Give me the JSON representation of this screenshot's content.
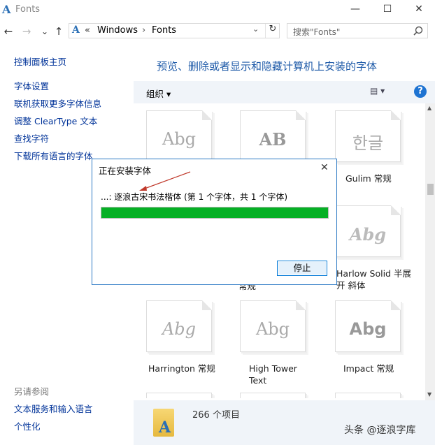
{
  "window": {
    "title": "Fonts",
    "minimize": "—",
    "maximize": "☐",
    "close": "✕"
  },
  "nav": {
    "back": "←",
    "forward": "→",
    "recent": "⌄",
    "up": "↑",
    "refresh": "↻",
    "breadcrumb": [
      "Windows",
      "Fonts"
    ],
    "breadcrumb_sep": "›",
    "breadcrumb_prefix": "«",
    "search_placeholder": "搜索\"Fonts\""
  },
  "left_pane": {
    "home": "控制面板主页",
    "links": [
      "字体设置",
      "联机获取更多字体信息",
      "调整 ClearType 文本",
      "查找字符",
      "下载所有语言的字体"
    ],
    "see_also_title": "另请参阅",
    "see_also": [
      "文本服务和输入语言",
      "个性化"
    ]
  },
  "main": {
    "heading": "预览、删除或者显示和隐藏计算机上安装的字体",
    "organize": "组织 ▾",
    "help": "?",
    "view": "▤ ▾"
  },
  "fonts": [
    {
      "sample": "Abg",
      "label": ""
    },
    {
      "sample": "AB",
      "label": ""
    },
    {
      "sample": "한글",
      "label": "Gulim 常规"
    },
    {
      "sample": "",
      "label": ""
    },
    {
      "sample": "",
      "label": "常规"
    },
    {
      "sample": "Abg",
      "label": "Harlow Solid 半展开 斜体"
    },
    {
      "sample": "Abg",
      "label": "Harrington 常规"
    },
    {
      "sample": "Abg",
      "label": "High Tower Text"
    },
    {
      "sample": "Abg",
      "label": "Impact 常规"
    }
  ],
  "status": {
    "count": "266 个项目"
  },
  "dialog": {
    "title": "正在安装字体",
    "close": "✕",
    "message": "...: 逐浪古宋书法楷体 (第 1 个字体，共 1 个字体)",
    "progress": 1.0,
    "stop_button": "停止"
  },
  "watermark": "头条 @逐浪字库",
  "colors": {
    "link": "#003399",
    "heading": "#1e5aa8",
    "progress": "#06b025",
    "help": "#1e73d2"
  }
}
